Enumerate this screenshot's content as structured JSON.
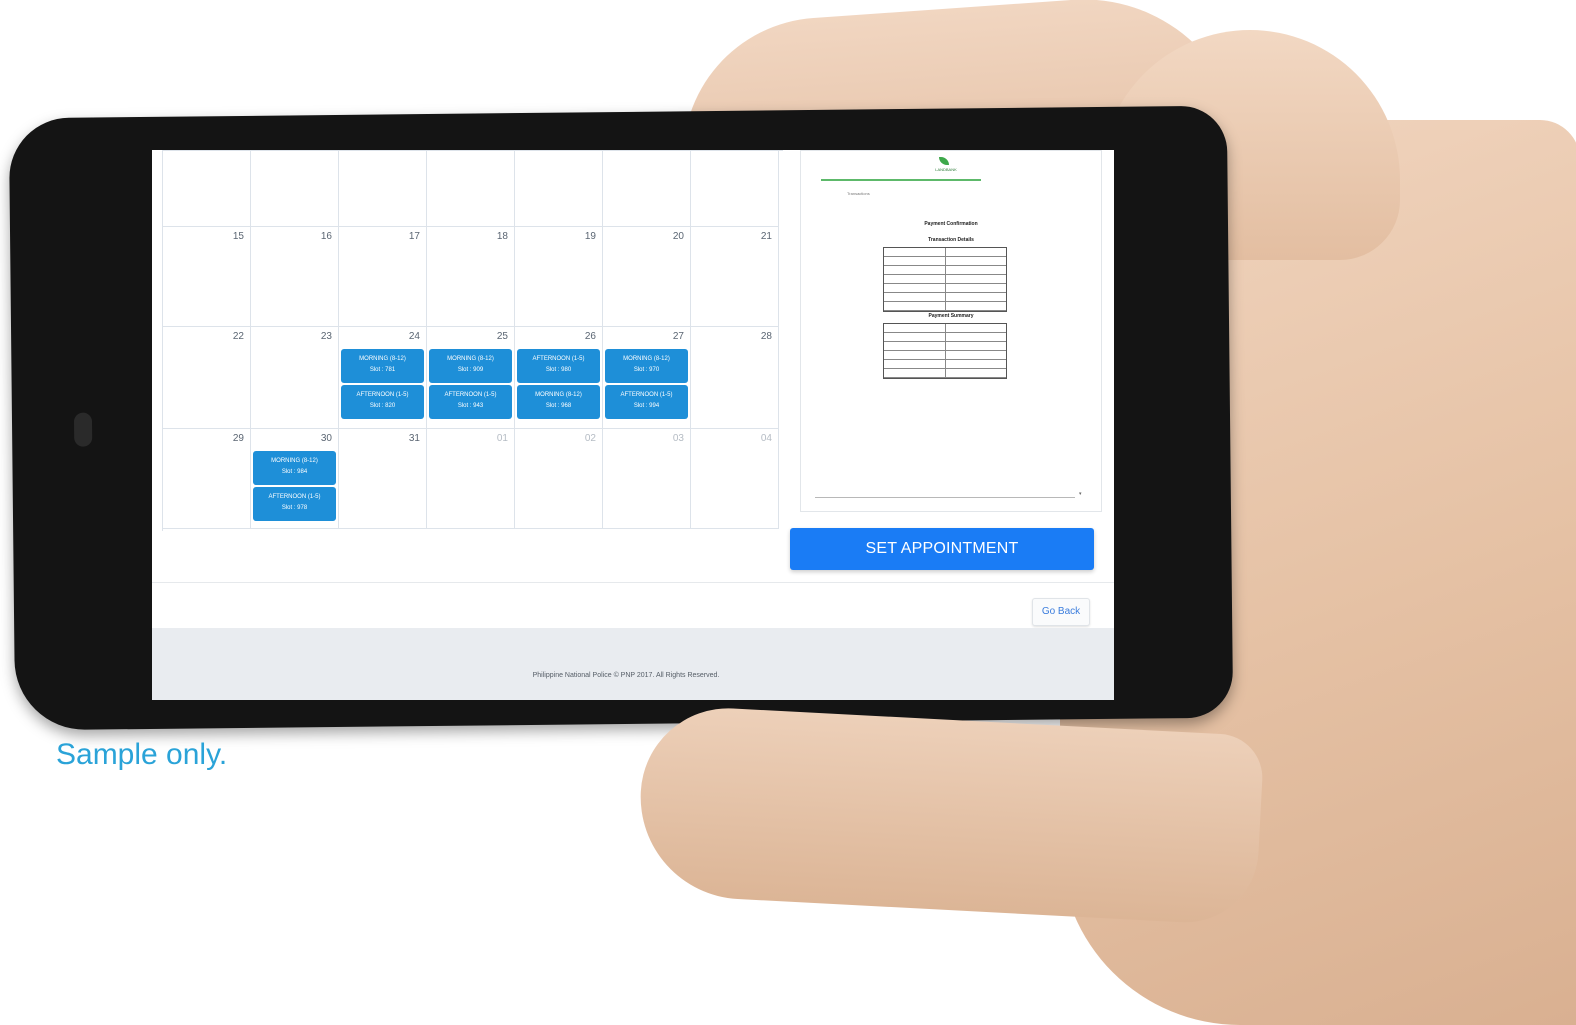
{
  "calendar": {
    "weeks": [
      {
        "days": [
          {
            "num": ""
          },
          {
            "num": ""
          },
          {
            "num": ""
          },
          {
            "num": ""
          },
          {
            "num": ""
          },
          {
            "num": ""
          },
          {
            "num": ""
          }
        ]
      },
      {
        "days": [
          {
            "num": "15"
          },
          {
            "num": "16"
          },
          {
            "num": "17"
          },
          {
            "num": "18"
          },
          {
            "num": "19"
          },
          {
            "num": "20"
          },
          {
            "num": "21"
          }
        ]
      },
      {
        "days": [
          {
            "num": "22"
          },
          {
            "num": "23"
          },
          {
            "num": "24",
            "slots": [
              {
                "label": "MORNING (8-12)",
                "slot": "Slot : 781"
              },
              {
                "label": "AFTERNOON (1-5)",
                "slot": "Slot : 820"
              }
            ]
          },
          {
            "num": "25",
            "slots": [
              {
                "label": "MORNING (8-12)",
                "slot": "Slot : 909"
              },
              {
                "label": "AFTERNOON (1-5)",
                "slot": "Slot : 943"
              }
            ]
          },
          {
            "num": "26",
            "slots": [
              {
                "label": "AFTERNOON (1-5)",
                "slot": "Slot : 980"
              },
              {
                "label": "MORNING (8-12)",
                "slot": "Slot : 968"
              }
            ]
          },
          {
            "num": "27",
            "slots": [
              {
                "label": "MORNING (8-12)",
                "slot": "Slot : 970"
              },
              {
                "label": "AFTERNOON (1-5)",
                "slot": "Slot : 994"
              }
            ]
          },
          {
            "num": "28"
          }
        ]
      },
      {
        "days": [
          {
            "num": "29"
          },
          {
            "num": "30",
            "slots": [
              {
                "label": "MORNING (8-12)",
                "slot": "Slot : 984"
              },
              {
                "label": "AFTERNOON (1-5)",
                "slot": "Slot : 978"
              }
            ]
          },
          {
            "num": "31"
          },
          {
            "num": "01",
            "muted": true
          },
          {
            "num": "02",
            "muted": true
          },
          {
            "num": "03",
            "muted": true
          },
          {
            "num": "04",
            "muted": true
          }
        ]
      }
    ]
  },
  "receipt": {
    "logo_text": "LANDBANK",
    "section": "Transactions",
    "title_confirmation": "Payment Confirmation",
    "title_details": "Transaction Details",
    "title_summary": "Payment Summary"
  },
  "actions": {
    "set_appointment": "SET APPOINTMENT",
    "go_back": "Go Back"
  },
  "footer": {
    "copyright": "Philippine National Police © PNP 2017. All Rights Reserved."
  },
  "caption": "Sample only.",
  "colors": {
    "accent": "#1a7cf5",
    "slot": "#1e8fd8",
    "caption": "#2aa3d8"
  }
}
